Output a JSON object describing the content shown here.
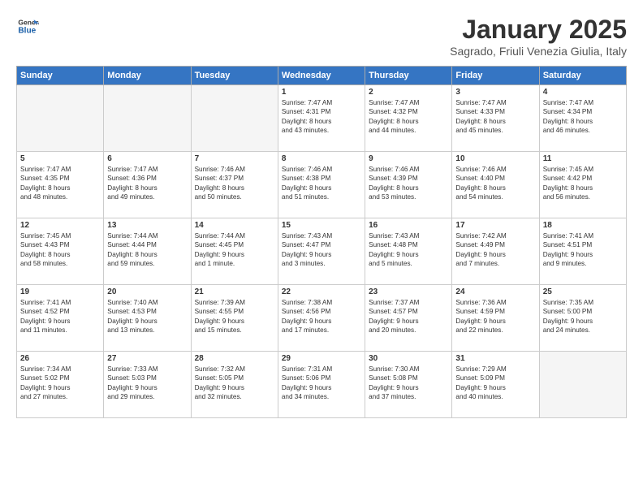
{
  "header": {
    "logo_line1": "General",
    "logo_line2": "Blue",
    "title": "January 2025",
    "subtitle": "Sagrado, Friuli Venezia Giulia, Italy"
  },
  "days_of_week": [
    "Sunday",
    "Monday",
    "Tuesday",
    "Wednesday",
    "Thursday",
    "Friday",
    "Saturday"
  ],
  "weeks": [
    [
      {
        "day": "",
        "content": "",
        "empty": true
      },
      {
        "day": "",
        "content": "",
        "empty": true
      },
      {
        "day": "",
        "content": "",
        "empty": true
      },
      {
        "day": "1",
        "content": "Sunrise: 7:47 AM\nSunset: 4:31 PM\nDaylight: 8 hours\nand 43 minutes."
      },
      {
        "day": "2",
        "content": "Sunrise: 7:47 AM\nSunset: 4:32 PM\nDaylight: 8 hours\nand 44 minutes."
      },
      {
        "day": "3",
        "content": "Sunrise: 7:47 AM\nSunset: 4:33 PM\nDaylight: 8 hours\nand 45 minutes."
      },
      {
        "day": "4",
        "content": "Sunrise: 7:47 AM\nSunset: 4:34 PM\nDaylight: 8 hours\nand 46 minutes."
      }
    ],
    [
      {
        "day": "5",
        "content": "Sunrise: 7:47 AM\nSunset: 4:35 PM\nDaylight: 8 hours\nand 48 minutes."
      },
      {
        "day": "6",
        "content": "Sunrise: 7:47 AM\nSunset: 4:36 PM\nDaylight: 8 hours\nand 49 minutes."
      },
      {
        "day": "7",
        "content": "Sunrise: 7:46 AM\nSunset: 4:37 PM\nDaylight: 8 hours\nand 50 minutes."
      },
      {
        "day": "8",
        "content": "Sunrise: 7:46 AM\nSunset: 4:38 PM\nDaylight: 8 hours\nand 51 minutes."
      },
      {
        "day": "9",
        "content": "Sunrise: 7:46 AM\nSunset: 4:39 PM\nDaylight: 8 hours\nand 53 minutes."
      },
      {
        "day": "10",
        "content": "Sunrise: 7:46 AM\nSunset: 4:40 PM\nDaylight: 8 hours\nand 54 minutes."
      },
      {
        "day": "11",
        "content": "Sunrise: 7:45 AM\nSunset: 4:42 PM\nDaylight: 8 hours\nand 56 minutes."
      }
    ],
    [
      {
        "day": "12",
        "content": "Sunrise: 7:45 AM\nSunset: 4:43 PM\nDaylight: 8 hours\nand 58 minutes."
      },
      {
        "day": "13",
        "content": "Sunrise: 7:44 AM\nSunset: 4:44 PM\nDaylight: 8 hours\nand 59 minutes."
      },
      {
        "day": "14",
        "content": "Sunrise: 7:44 AM\nSunset: 4:45 PM\nDaylight: 9 hours\nand 1 minute."
      },
      {
        "day": "15",
        "content": "Sunrise: 7:43 AM\nSunset: 4:47 PM\nDaylight: 9 hours\nand 3 minutes."
      },
      {
        "day": "16",
        "content": "Sunrise: 7:43 AM\nSunset: 4:48 PM\nDaylight: 9 hours\nand 5 minutes."
      },
      {
        "day": "17",
        "content": "Sunrise: 7:42 AM\nSunset: 4:49 PM\nDaylight: 9 hours\nand 7 minutes."
      },
      {
        "day": "18",
        "content": "Sunrise: 7:41 AM\nSunset: 4:51 PM\nDaylight: 9 hours\nand 9 minutes."
      }
    ],
    [
      {
        "day": "19",
        "content": "Sunrise: 7:41 AM\nSunset: 4:52 PM\nDaylight: 9 hours\nand 11 minutes."
      },
      {
        "day": "20",
        "content": "Sunrise: 7:40 AM\nSunset: 4:53 PM\nDaylight: 9 hours\nand 13 minutes."
      },
      {
        "day": "21",
        "content": "Sunrise: 7:39 AM\nSunset: 4:55 PM\nDaylight: 9 hours\nand 15 minutes."
      },
      {
        "day": "22",
        "content": "Sunrise: 7:38 AM\nSunset: 4:56 PM\nDaylight: 9 hours\nand 17 minutes."
      },
      {
        "day": "23",
        "content": "Sunrise: 7:37 AM\nSunset: 4:57 PM\nDaylight: 9 hours\nand 20 minutes."
      },
      {
        "day": "24",
        "content": "Sunrise: 7:36 AM\nSunset: 4:59 PM\nDaylight: 9 hours\nand 22 minutes."
      },
      {
        "day": "25",
        "content": "Sunrise: 7:35 AM\nSunset: 5:00 PM\nDaylight: 9 hours\nand 24 minutes."
      }
    ],
    [
      {
        "day": "26",
        "content": "Sunrise: 7:34 AM\nSunset: 5:02 PM\nDaylight: 9 hours\nand 27 minutes."
      },
      {
        "day": "27",
        "content": "Sunrise: 7:33 AM\nSunset: 5:03 PM\nDaylight: 9 hours\nand 29 minutes."
      },
      {
        "day": "28",
        "content": "Sunrise: 7:32 AM\nSunset: 5:05 PM\nDaylight: 9 hours\nand 32 minutes."
      },
      {
        "day": "29",
        "content": "Sunrise: 7:31 AM\nSunset: 5:06 PM\nDaylight: 9 hours\nand 34 minutes."
      },
      {
        "day": "30",
        "content": "Sunrise: 7:30 AM\nSunset: 5:08 PM\nDaylight: 9 hours\nand 37 minutes."
      },
      {
        "day": "31",
        "content": "Sunrise: 7:29 AM\nSunset: 5:09 PM\nDaylight: 9 hours\nand 40 minutes."
      },
      {
        "day": "",
        "content": "",
        "empty": true
      }
    ]
  ]
}
